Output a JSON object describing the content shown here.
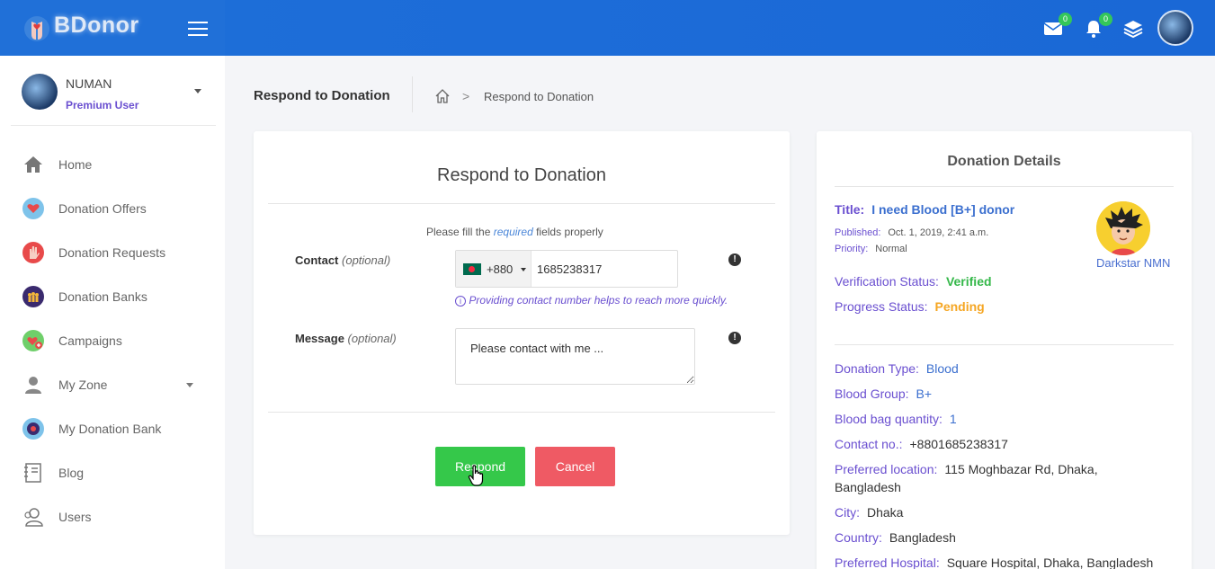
{
  "app": {
    "brand": "BDonor"
  },
  "topbar": {
    "mail_badge": "0",
    "notif_badge": "0"
  },
  "user": {
    "name": "NUMAN",
    "role": "Premium User"
  },
  "sidebar": {
    "items": [
      {
        "label": "Home",
        "icon": "home-icon"
      },
      {
        "label": "Donation Offers",
        "icon": "heart-hand-icon"
      },
      {
        "label": "Donation Requests",
        "icon": "raised-hand-icon"
      },
      {
        "label": "Donation Banks",
        "icon": "people-group-icon"
      },
      {
        "label": "Campaigns",
        "icon": "campaign-heart-icon"
      },
      {
        "label": "My Zone",
        "icon": "person-icon"
      },
      {
        "label": "My Donation Bank",
        "icon": "bank-icon"
      },
      {
        "label": "Blog",
        "icon": "notebook-icon"
      },
      {
        "label": "Users",
        "icon": "users-icon"
      }
    ]
  },
  "breadcrumb": {
    "page_title": "Respond to Donation",
    "current": "Respond to Donation",
    "chevron": ">"
  },
  "form": {
    "title": "Respond to Donation",
    "hint_prefix": "Please fill the",
    "hint_required": "required",
    "hint_suffix": "fields properly",
    "contact_label": "Contact",
    "optional": "(optional)",
    "dial_code": "+880",
    "phone_value": "1685238317",
    "contact_help": "Providing contact number helps to reach more quickly.",
    "message_label": "Message",
    "message_value": "Please contact with me ...",
    "respond_label": "Respond",
    "cancel_label": "Cancel"
  },
  "details": {
    "heading": "Donation Details",
    "title_label": "Title:",
    "title_value": "I need Blood [B+] donor",
    "published_label": "Published:",
    "published_value": "Oct. 1, 2019, 2:41 a.m.",
    "priority_label": "Priority:",
    "priority_value": "Normal",
    "donor_name": "Darkstar NMN",
    "verification_label": "Verification Status:",
    "verification_value": "Verified",
    "progress_label": "Progress Status:",
    "progress_value": "Pending",
    "donation_type_label": "Donation Type:",
    "donation_type_value": "Blood",
    "blood_group_label": "Blood Group:",
    "blood_group_value": "B+",
    "bag_qty_label": "Blood bag quantity:",
    "bag_qty_value": "1",
    "contact_label": "Contact no.:",
    "contact_value": "+8801685238317",
    "location_label": "Preferred location:",
    "location_value": "115 Moghbazar Rd, Dhaka,",
    "location_value_2": "Bangladesh",
    "city_label": "City:",
    "city_value": "Dhaka",
    "country_label": "Country:",
    "country_value": "Bangladesh",
    "hospital_label": "Preferred Hospital:",
    "hospital_value": "Square Hospital, Dhaka, Bangladesh"
  },
  "colors": {
    "topbar": "#1e6fd9",
    "accent_purple": "#6a4fd0",
    "respond": "#35c84a",
    "cancel": "#ef5a64",
    "verified": "#35b84a",
    "pending": "#f5a623"
  }
}
